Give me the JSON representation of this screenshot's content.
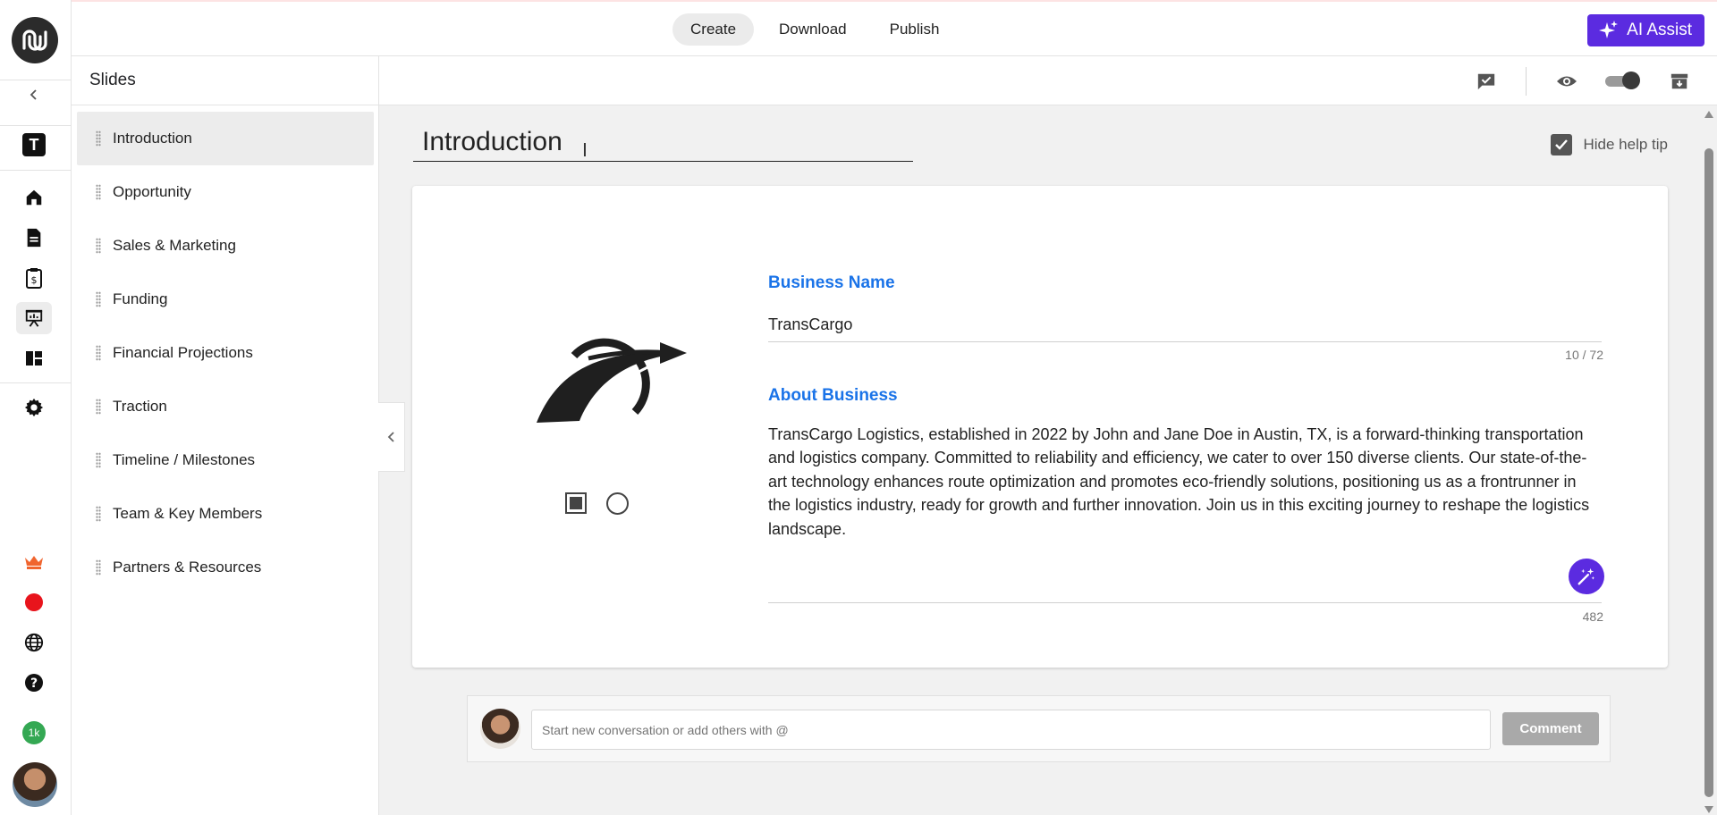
{
  "app": {
    "name": "Business plan editor"
  },
  "rail": {
    "template_badge": "T",
    "points_badge": "1k",
    "items": [
      {
        "icon": "home-icon"
      },
      {
        "icon": "document-icon"
      },
      {
        "icon": "invoice-icon"
      },
      {
        "icon": "presentation-icon"
      },
      {
        "icon": "dashboard-icon"
      },
      {
        "icon": "settings-icon"
      }
    ],
    "bottom": [
      {
        "icon": "crown-icon"
      },
      {
        "icon": "record-icon"
      },
      {
        "icon": "globe-icon"
      },
      {
        "icon": "help-icon"
      }
    ]
  },
  "topbar": {
    "tabs": [
      {
        "label": "Create",
        "active": true
      },
      {
        "label": "Download",
        "active": false
      },
      {
        "label": "Publish",
        "active": false
      }
    ],
    "ai_button": "AI Assist"
  },
  "slides_panel": {
    "title": "Slides",
    "items": [
      {
        "label": "Introduction",
        "active": true
      },
      {
        "label": "Opportunity"
      },
      {
        "label": "Sales & Marketing"
      },
      {
        "label": "Funding"
      },
      {
        "label": "Financial Projections"
      },
      {
        "label": "Traction"
      },
      {
        "label": "Timeline / Milestones"
      },
      {
        "label": "Team & Key Members"
      },
      {
        "label": "Partners & Resources"
      }
    ]
  },
  "toolbar": {
    "icons": [
      "comment-check-icon",
      "eye-icon",
      "toggle-switch",
      "archive-icon"
    ],
    "toggle_on": true
  },
  "editor": {
    "slide_title": "Introduction",
    "help_tip_label": "Hide help tip",
    "help_tip_checked": true,
    "business_name_label": "Business Name",
    "business_name_value": "TransCargo",
    "business_name_counter": "10 / 72",
    "about_label": "About Business",
    "about_text": "TransCargo Logistics, established in 2022 by John and Jane Doe in Austin, TX, is a forward-thinking transportation and logistics company. Committed to reliability and efficiency, we cater to over 150 diverse clients. Our state-of-the-art technology enhances route optimization and promotes eco-friendly solutions, positioning us as a frontrunner in the logistics industry, ready for growth and further innovation. Join us in this exciting journey to reshape the logistics landscape.",
    "about_counter": "482"
  },
  "comments": {
    "placeholder": "Start new conversation or add others with @",
    "button": "Comment"
  },
  "colors": {
    "accent": "#5b2be0",
    "label_blue": "#1a73e8",
    "record_red": "#e8141c",
    "crown_orange": "#f0652f",
    "points_green": "#34a853"
  }
}
